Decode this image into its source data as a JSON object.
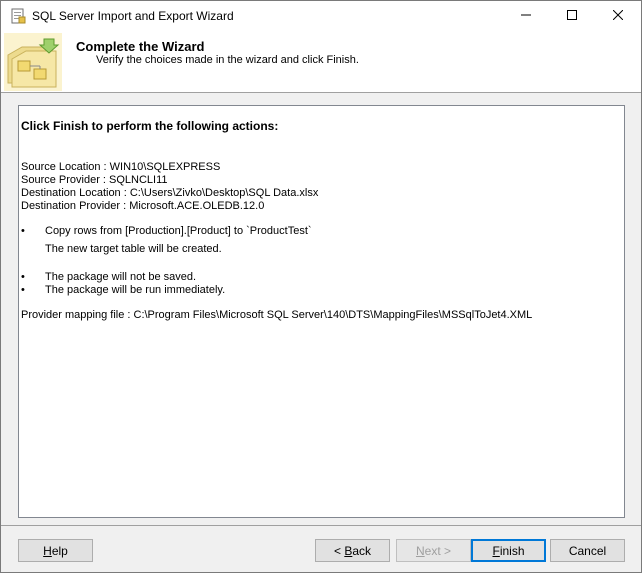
{
  "window": {
    "title": "SQL Server Import and Export Wizard"
  },
  "header": {
    "title": "Complete the Wizard",
    "subtitle": "Verify the choices made in the wizard and click Finish."
  },
  "report": {
    "heading": "Click Finish to perform the following actions:",
    "details": [
      "Source Location : WIN10\\SQLEXPRESS",
      "Source Provider : SQLNCLI11",
      "Destination Location : C:\\Users\\Zivko\\Desktop\\SQL Data.xlsx",
      "Destination Provider : Microsoft.ACE.OLEDB.12.0"
    ],
    "bullet_char": "•",
    "copy_action": "Copy rows from [Production].[Product] to `ProductTest`",
    "copy_note": "The new target table will be created.",
    "package_saved": "The package will not be saved.",
    "package_run": "The package will be run immediately.",
    "mapping_file": "Provider mapping file : C:\\Program Files\\Microsoft SQL Server\\140\\DTS\\MappingFiles\\MSSqlToJet4.XML"
  },
  "buttons": {
    "help": {
      "mnemonic": "H",
      "rest": "elp"
    },
    "back": {
      "prefix": "< ",
      "mnemonic": "B",
      "rest": "ack"
    },
    "next": {
      "mnemonic": "N",
      "rest": "ext >"
    },
    "finish": {
      "mnemonic": "F",
      "rest": "inish"
    },
    "cancel": "Cancel"
  },
  "icons": {
    "title_icon": "wizard-app-icon",
    "header_icon": "wizard-folder-icon",
    "minimize": "minimize-icon",
    "maximize": "maximize-icon",
    "close": "close-icon"
  },
  "colors": {
    "default_button_border": "#0078d7",
    "window_bg": "#f0f0f0"
  }
}
